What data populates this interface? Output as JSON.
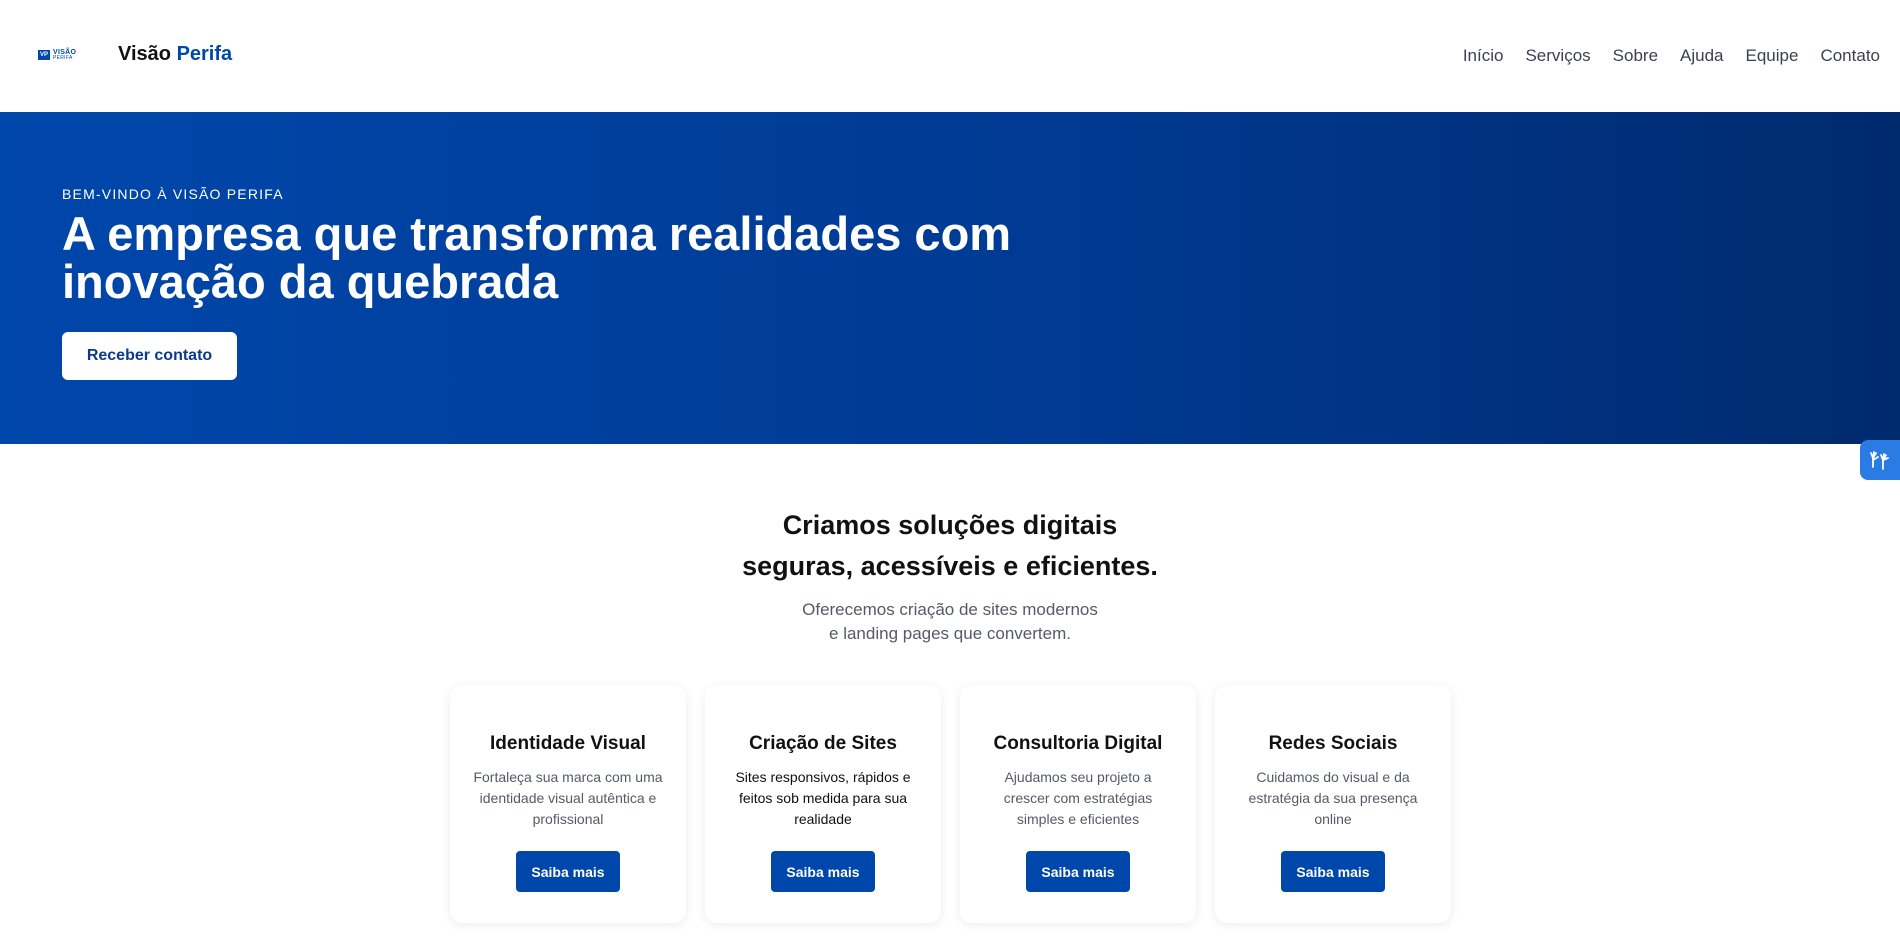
{
  "header": {
    "logo": {
      "mark": "VP",
      "line1": "VISÃO",
      "line2": "PERIFA"
    },
    "brand": {
      "part1": "Visão ",
      "part2": "Perifa"
    },
    "nav": [
      "Início",
      "Serviços",
      "Sobre",
      "Ajuda",
      "Equipe",
      "Contato"
    ]
  },
  "hero": {
    "kicker": "BEM-VINDO À VISÃO PERIFA",
    "title": "A empresa que transforma realidades com inovação da quebrada",
    "cta": "Receber contato"
  },
  "section": {
    "title_line1": "Criamos soluções digitais",
    "title_line2": "seguras, acessíveis e eficientes.",
    "sub_line1": "Oferecemos criação de sites modernos",
    "sub_line2": "e landing pages que convertem."
  },
  "cards": [
    {
      "title": "Identidade Visual",
      "desc": "Fortaleça sua marca com uma identidade visual autêntica e profissional",
      "button": "Saiba mais"
    },
    {
      "title": "Criação de Sites",
      "desc": "Sites responsivos, rápidos e feitos sob medida para sua realidade",
      "button": "Saiba mais"
    },
    {
      "title": "Consultoria Digital",
      "desc": "Ajudamos seu projeto a crescer com estratégias simples e eficientes",
      "button": "Saiba mais"
    },
    {
      "title": "Redes Sociais",
      "desc": "Cuidamos do visual e da estratégia da sua presença online",
      "button": "Saiba mais"
    }
  ],
  "widget": {
    "icon": "sign-language-hands-icon"
  },
  "colors": {
    "primary": "#0047ab",
    "hero_end": "#002a6e",
    "widget": "#2b7be4"
  }
}
